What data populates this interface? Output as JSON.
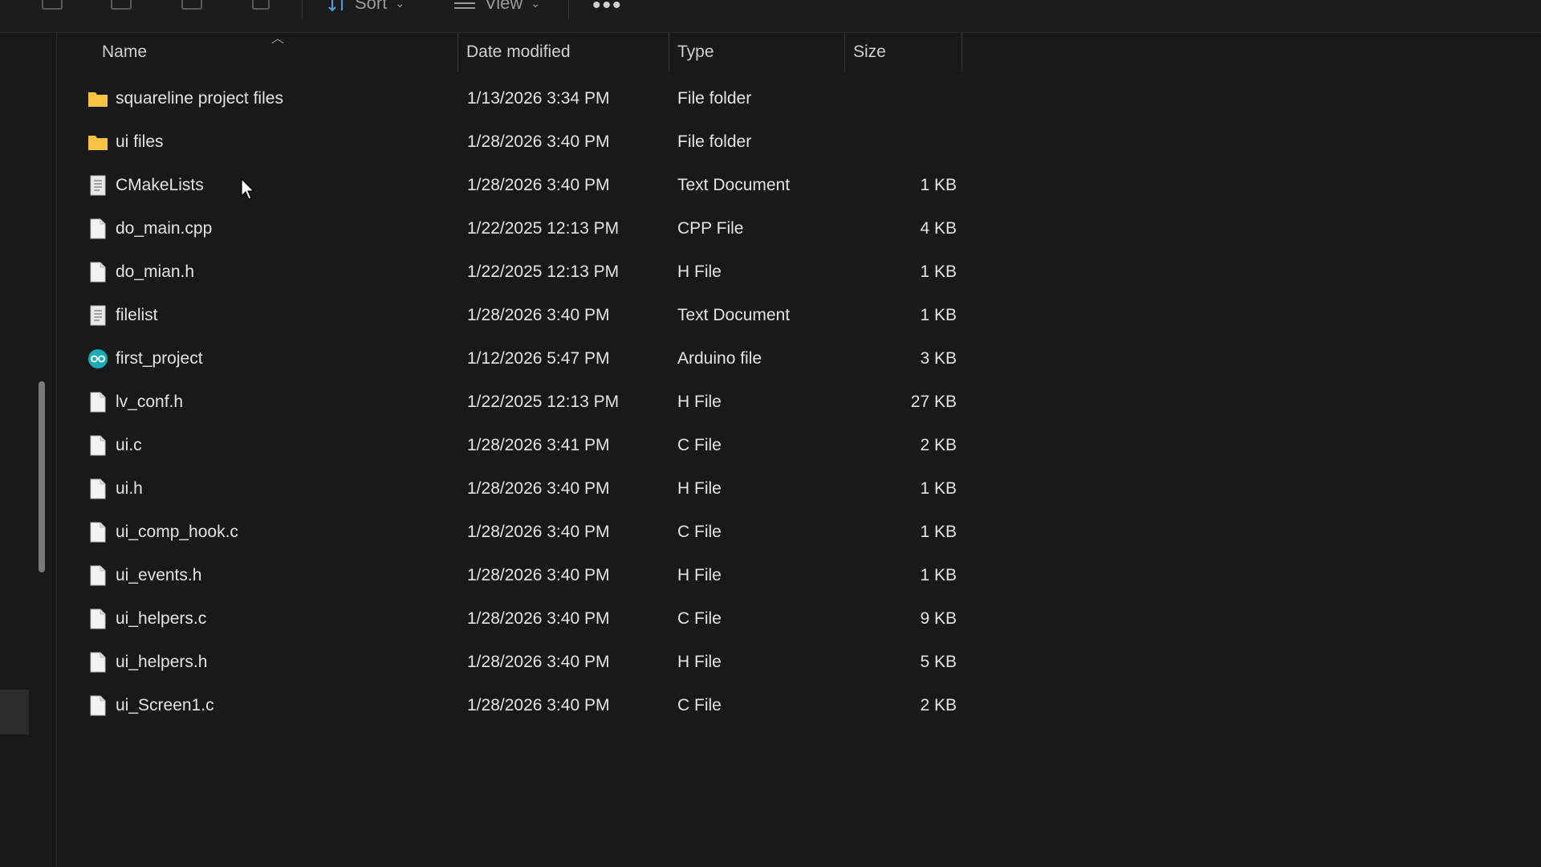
{
  "toolbar": {
    "sort_label": "Sort",
    "view_label": "View",
    "more_label": "•••"
  },
  "columns": {
    "name": "Name",
    "date": "Date modified",
    "type": "Type",
    "size": "Size"
  },
  "files": [
    {
      "icon": "folder-icon",
      "name": "squareline project files",
      "date": "1/13/2026 3:34 PM",
      "type": "File folder",
      "size": ""
    },
    {
      "icon": "folder-icon",
      "name": "ui files",
      "date": "1/28/2026 3:40 PM",
      "type": "File folder",
      "size": ""
    },
    {
      "icon": "text-document-icon",
      "name": "CMakeLists",
      "date": "1/28/2026 3:40 PM",
      "type": "Text Document",
      "size": "1 KB"
    },
    {
      "icon": "file-icon",
      "name": "do_main.cpp",
      "date": "1/22/2025 12:13 PM",
      "type": "CPP File",
      "size": "4 KB"
    },
    {
      "icon": "file-icon",
      "name": "do_mian.h",
      "date": "1/22/2025 12:13 PM",
      "type": "H File",
      "size": "1 KB"
    },
    {
      "icon": "text-document-icon",
      "name": "filelist",
      "date": "1/28/2026 3:40 PM",
      "type": "Text Document",
      "size": "1 KB"
    },
    {
      "icon": "arduino-icon",
      "name": "first_project",
      "date": "1/12/2026 5:47 PM",
      "type": "Arduino file",
      "size": "3 KB"
    },
    {
      "icon": "file-icon",
      "name": "lv_conf.h",
      "date": "1/22/2025 12:13 PM",
      "type": "H File",
      "size": "27 KB"
    },
    {
      "icon": "file-icon",
      "name": "ui.c",
      "date": "1/28/2026 3:41 PM",
      "type": "C File",
      "size": "2 KB"
    },
    {
      "icon": "file-icon",
      "name": "ui.h",
      "date": "1/28/2026 3:40 PM",
      "type": "H File",
      "size": "1 KB"
    },
    {
      "icon": "file-icon",
      "name": "ui_comp_hook.c",
      "date": "1/28/2026 3:40 PM",
      "type": "C File",
      "size": "1 KB"
    },
    {
      "icon": "file-icon",
      "name": "ui_events.h",
      "date": "1/28/2026 3:40 PM",
      "type": "H File",
      "size": "1 KB"
    },
    {
      "icon": "file-icon",
      "name": "ui_helpers.c",
      "date": "1/28/2026 3:40 PM",
      "type": "C File",
      "size": "9 KB"
    },
    {
      "icon": "file-icon",
      "name": "ui_helpers.h",
      "date": "1/28/2026 3:40 PM",
      "type": "H File",
      "size": "5 KB"
    },
    {
      "icon": "file-icon",
      "name": "ui_Screen1.c",
      "date": "1/28/2026 3:40 PM",
      "type": "C File",
      "size": "2 KB"
    }
  ],
  "colors": {
    "folder": "#f5c242",
    "arduino": "#1aa9b6",
    "accent": "#4aa3df"
  }
}
